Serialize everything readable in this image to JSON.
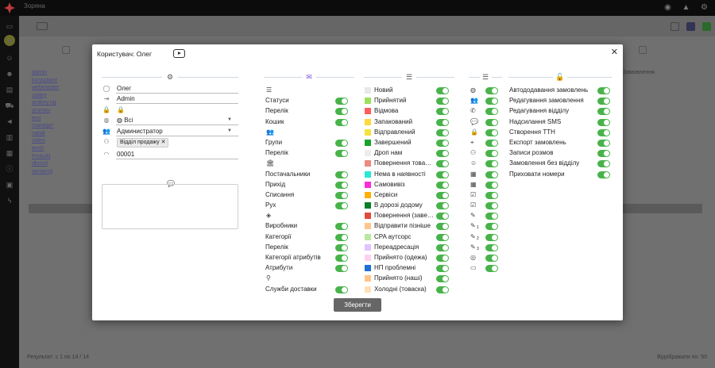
{
  "app": {
    "brand": "Зоряна"
  },
  "background": {
    "list": [
      "admin",
      "konsultant",
      "webmaster",
      "salary",
      "andrey.ng",
      "gromov",
      "test",
      "manager",
      "natali",
      "video",
      "test2",
      "Prokofii",
      "dbrcrd",
      "tarnavsjj"
    ],
    "pagination_left": "Результат: с 1 по 14 / 14",
    "pagination_right": "Відображати по: 50",
    "col_header": "Замовлення"
  },
  "modal": {
    "title": "Користувач: Олег",
    "close": "✕",
    "save": "Зберегти"
  },
  "form": {
    "name": "Олег",
    "login": "Admin",
    "password": "",
    "region": "Всі",
    "role": "Администратор",
    "department_tag": "Відділ продажу",
    "code": "00001",
    "comment": ""
  },
  "col1": [
    {
      "type": "icon",
      "icon": "list-icon",
      "g": "☰"
    },
    {
      "type": "item",
      "label": "Статуси"
    },
    {
      "type": "item",
      "label": "Перелік"
    },
    {
      "type": "item",
      "label": "Кошик"
    },
    {
      "type": "icon",
      "icon": "users-icon",
      "g": "👥"
    },
    {
      "type": "item",
      "label": "Групи"
    },
    {
      "type": "item",
      "label": "Перелік"
    },
    {
      "type": "icon",
      "icon": "warehouse-icon",
      "g": "🏛"
    },
    {
      "type": "item",
      "label": "Постачальники"
    },
    {
      "type": "item",
      "label": "Прихід"
    },
    {
      "type": "item",
      "label": "Списання"
    },
    {
      "type": "item",
      "label": "Рух"
    },
    {
      "type": "icon",
      "icon": "box-icon",
      "g": "◈"
    },
    {
      "type": "item",
      "label": "Виробники"
    },
    {
      "type": "item",
      "label": "Категорії"
    },
    {
      "type": "item",
      "label": "Перелік"
    },
    {
      "type": "item",
      "label": "Категорії атрибутів"
    },
    {
      "type": "item",
      "label": "Атрибути"
    },
    {
      "type": "icon",
      "icon": "delivery-icon",
      "g": "⚲"
    },
    {
      "type": "item",
      "label": "Служби доставки"
    }
  ],
  "statuses": [
    {
      "label": "Новий",
      "color": "#e8e8e8"
    },
    {
      "label": "Прийнятий",
      "color": "#9be05a"
    },
    {
      "label": "Відмова",
      "color": "#ff5d5d"
    },
    {
      "label": "Запакований",
      "color": "#ffd83a"
    },
    {
      "label": "Відправлений",
      "color": "#f5e23b"
    },
    {
      "label": "Завершений",
      "color": "#17a32a"
    },
    {
      "label": "Дроп нам",
      "color": "#ededed"
    },
    {
      "label": "Повернення това…",
      "color": "#ec8a80"
    },
    {
      "label": "Нема в наявності",
      "color": "#27e8d6"
    },
    {
      "label": "Самовивіз",
      "color": "#ff2bd9"
    },
    {
      "label": "Сервіси",
      "color": "#ffb000"
    },
    {
      "label": "В дорозі додому",
      "color": "#0f7d2a"
    },
    {
      "label": "Повернення (заве…",
      "color": "#e24a3c"
    },
    {
      "label": "Відправити пізніше",
      "color": "#ffc58a"
    },
    {
      "label": "CPA аутсорс",
      "color": "#b8e8a0"
    },
    {
      "label": "Переадресація",
      "color": "#e2c2ff"
    },
    {
      "label": "Прийнято (одежа)",
      "color": "#ffd0f0"
    },
    {
      "label": "НП проблемні",
      "color": "#1e6fd6"
    },
    {
      "label": "Прийнято (наші)",
      "color": "#ffc48a"
    },
    {
      "label": "Холодні (товаска)",
      "color": "#ffe0b8"
    }
  ],
  "col3_icons": [
    "globe-icon",
    "users-icon",
    "phone-icon",
    "chat-icon",
    "lock-icon",
    "location-icon",
    "sitemap-icon",
    "user-circle-icon",
    "calendar-icon",
    "calendar-icon",
    "calendar-check-icon",
    "calendar-check-icon",
    "pencil-icon",
    "pencil-icon",
    "pencil-icon",
    "pencil-icon",
    "web-icon",
    "monitor-icon"
  ],
  "col3_glyphs": [
    "◍",
    "👥",
    "✆",
    "💬",
    "🔒",
    "⌖",
    "⚇",
    "☺",
    "▦",
    "▦",
    "☑",
    "☑",
    "✎",
    "✎",
    "✎",
    "✎",
    "◎",
    "▭"
  ],
  "col3_sub": [
    "",
    "",
    "",
    "",
    "",
    "",
    "",
    "",
    "",
    "",
    "",
    "",
    "",
    "1",
    "2",
    "3",
    "",
    ""
  ],
  "col4": [
    "Автододавання замовлень",
    "Редагування замовлення",
    "Редагування відділу",
    "Надсилання SMS",
    "Створення ТТН",
    "Експорт замовлень",
    "Записи розмов",
    "Замовлення без відділу",
    "Приховати номери"
  ],
  "colors": {
    "toggle_on": "#48b34a",
    "save_bg": "#666666"
  }
}
